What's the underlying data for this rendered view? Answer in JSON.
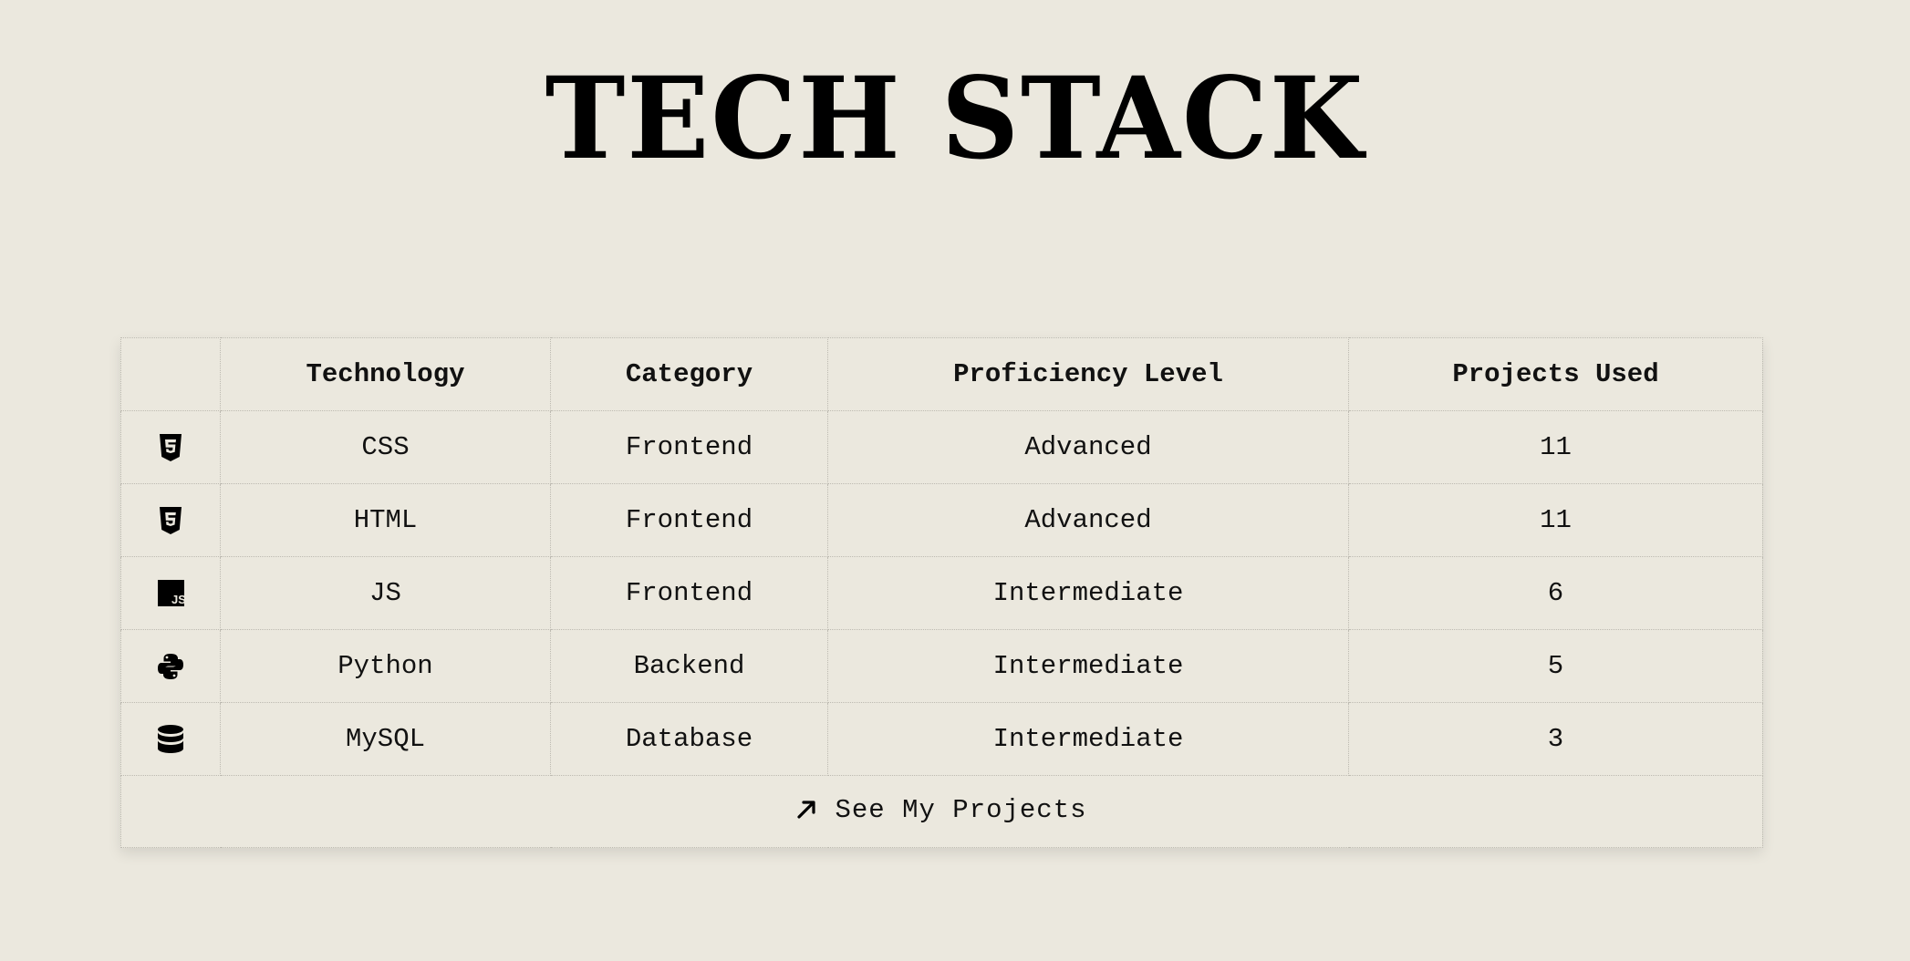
{
  "header": {
    "title": "TECH STACK"
  },
  "table": {
    "columns": [
      "",
      "Technology",
      "Category",
      "Proficiency Level",
      "Projects Used"
    ],
    "rows": [
      {
        "icon": "css3-icon",
        "technology": "CSS",
        "category": "Frontend",
        "proficiency": "Advanced",
        "projects": "11"
      },
      {
        "icon": "html5-icon",
        "technology": "HTML",
        "category": "Frontend",
        "proficiency": "Advanced",
        "projects": "11"
      },
      {
        "icon": "javascript-icon",
        "technology": "JS",
        "category": "Frontend",
        "proficiency": "Intermediate",
        "projects": "6"
      },
      {
        "icon": "python-icon",
        "technology": "Python",
        "category": "Backend",
        "proficiency": "Intermediate",
        "projects": "5"
      },
      {
        "icon": "database-icon",
        "technology": "MySQL",
        "category": "Database",
        "proficiency": "Intermediate",
        "projects": "3"
      }
    ],
    "footer_link": {
      "icon": "arrow-up-right-icon",
      "label": "See My Projects"
    }
  },
  "colors": {
    "background": "#ebe8de",
    "text": "#111111",
    "border": "#bdbab1"
  }
}
